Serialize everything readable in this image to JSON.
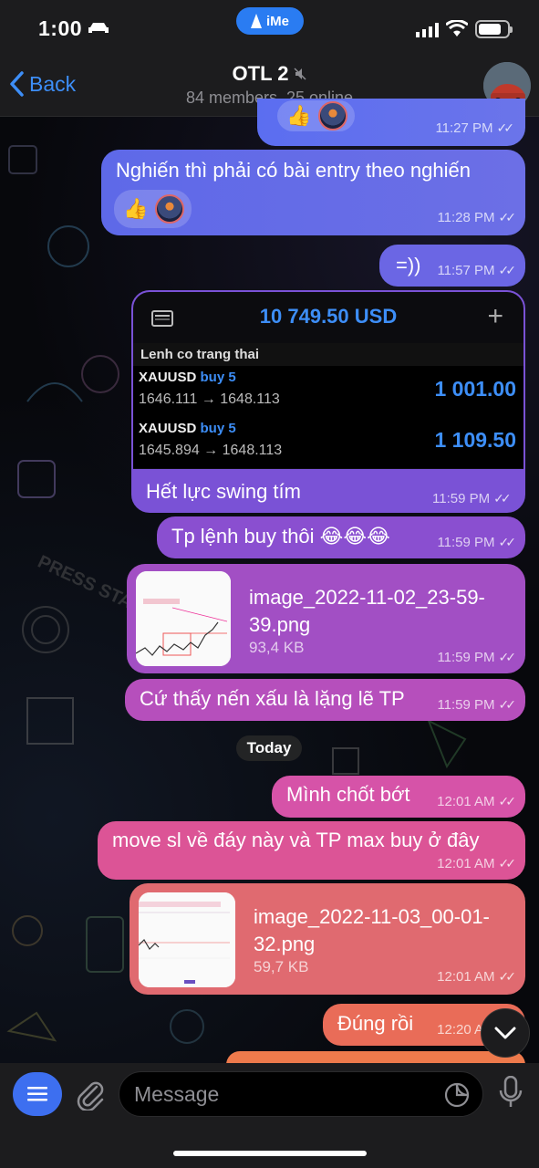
{
  "status": {
    "time": "1:00",
    "ime_label": "iMe"
  },
  "header": {
    "back_label": "Back",
    "title": "OTL 2",
    "subtitle": "84 members, 25 online"
  },
  "messages": [
    {
      "time": "11:27 PM"
    },
    {
      "text": "Nghiến thì phải có bài entry theo nghiến",
      "time": "11:28 PM"
    },
    {
      "text": "=))",
      "time": "11:57 PM"
    },
    {
      "text": "Hết lực swing tím",
      "time": "11:59 PM"
    },
    {
      "text": "Tp lệnh buy thôi 😂😂😂",
      "time": "11:59 PM"
    },
    {
      "file_name": "image_2022-11-02_23-59-39.png",
      "file_line1": "image_2022-11-02_23-59-",
      "file_line2": "39.png",
      "file_size": "93,4 KB",
      "time": "11:59 PM"
    },
    {
      "text": "Cứ thấy nến xấu là lặng lẽ TP",
      "time": "11:59 PM"
    },
    {
      "text": "Mình chốt bớt",
      "time": "12:01 AM"
    },
    {
      "text": "move sl về đáy này và TP max buy ở đây",
      "time": "12:01 AM"
    },
    {
      "file_name": "image_2022-11-03_00-01-32.png",
      "file_line1": "image_2022-11-03_00-01-",
      "file_line2": "32.png",
      "file_size": "59,7 KB",
      "time": "12:01 AM"
    },
    {
      "text": "Đúng rồi",
      "time": "12:20 AM"
    }
  ],
  "trade_card": {
    "balance": "10 749.50 USD",
    "section": "Lenh co trang thai",
    "trades": [
      {
        "symbol": "XAUUSD",
        "side": "buy 5",
        "prices": "1646.111 → 1648.113",
        "profit": "1 001.00"
      },
      {
        "symbol": "XAUUSD",
        "side": "buy 5",
        "prices": "1645.894 → 1648.113",
        "profit": "1 109.50"
      }
    ]
  },
  "date_divider": "Today",
  "input": {
    "placeholder": "Message"
  },
  "colors": {
    "accent": "#3d8ef7",
    "menu_button": "#3d6ff0"
  }
}
